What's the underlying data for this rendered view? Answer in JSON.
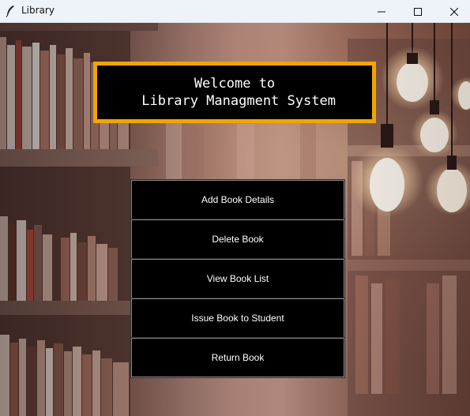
{
  "window": {
    "title": "Library",
    "icon": "feather-icon",
    "controls": [
      "minimize-icon",
      "maximize-icon",
      "close-icon"
    ]
  },
  "header": {
    "line1": "Welcome to",
    "line2": " Library Managment System"
  },
  "menu": {
    "buttons": [
      {
        "label": "Add Book Details"
      },
      {
        "label": "Delete Book"
      },
      {
        "label": "View Book List"
      },
      {
        "label": "Issue Book to Student"
      },
      {
        "label": "Return Book"
      }
    ]
  },
  "colors": {
    "header_border": "#f0a500",
    "button_bg": "#000000",
    "button_text": "#ffffff"
  }
}
